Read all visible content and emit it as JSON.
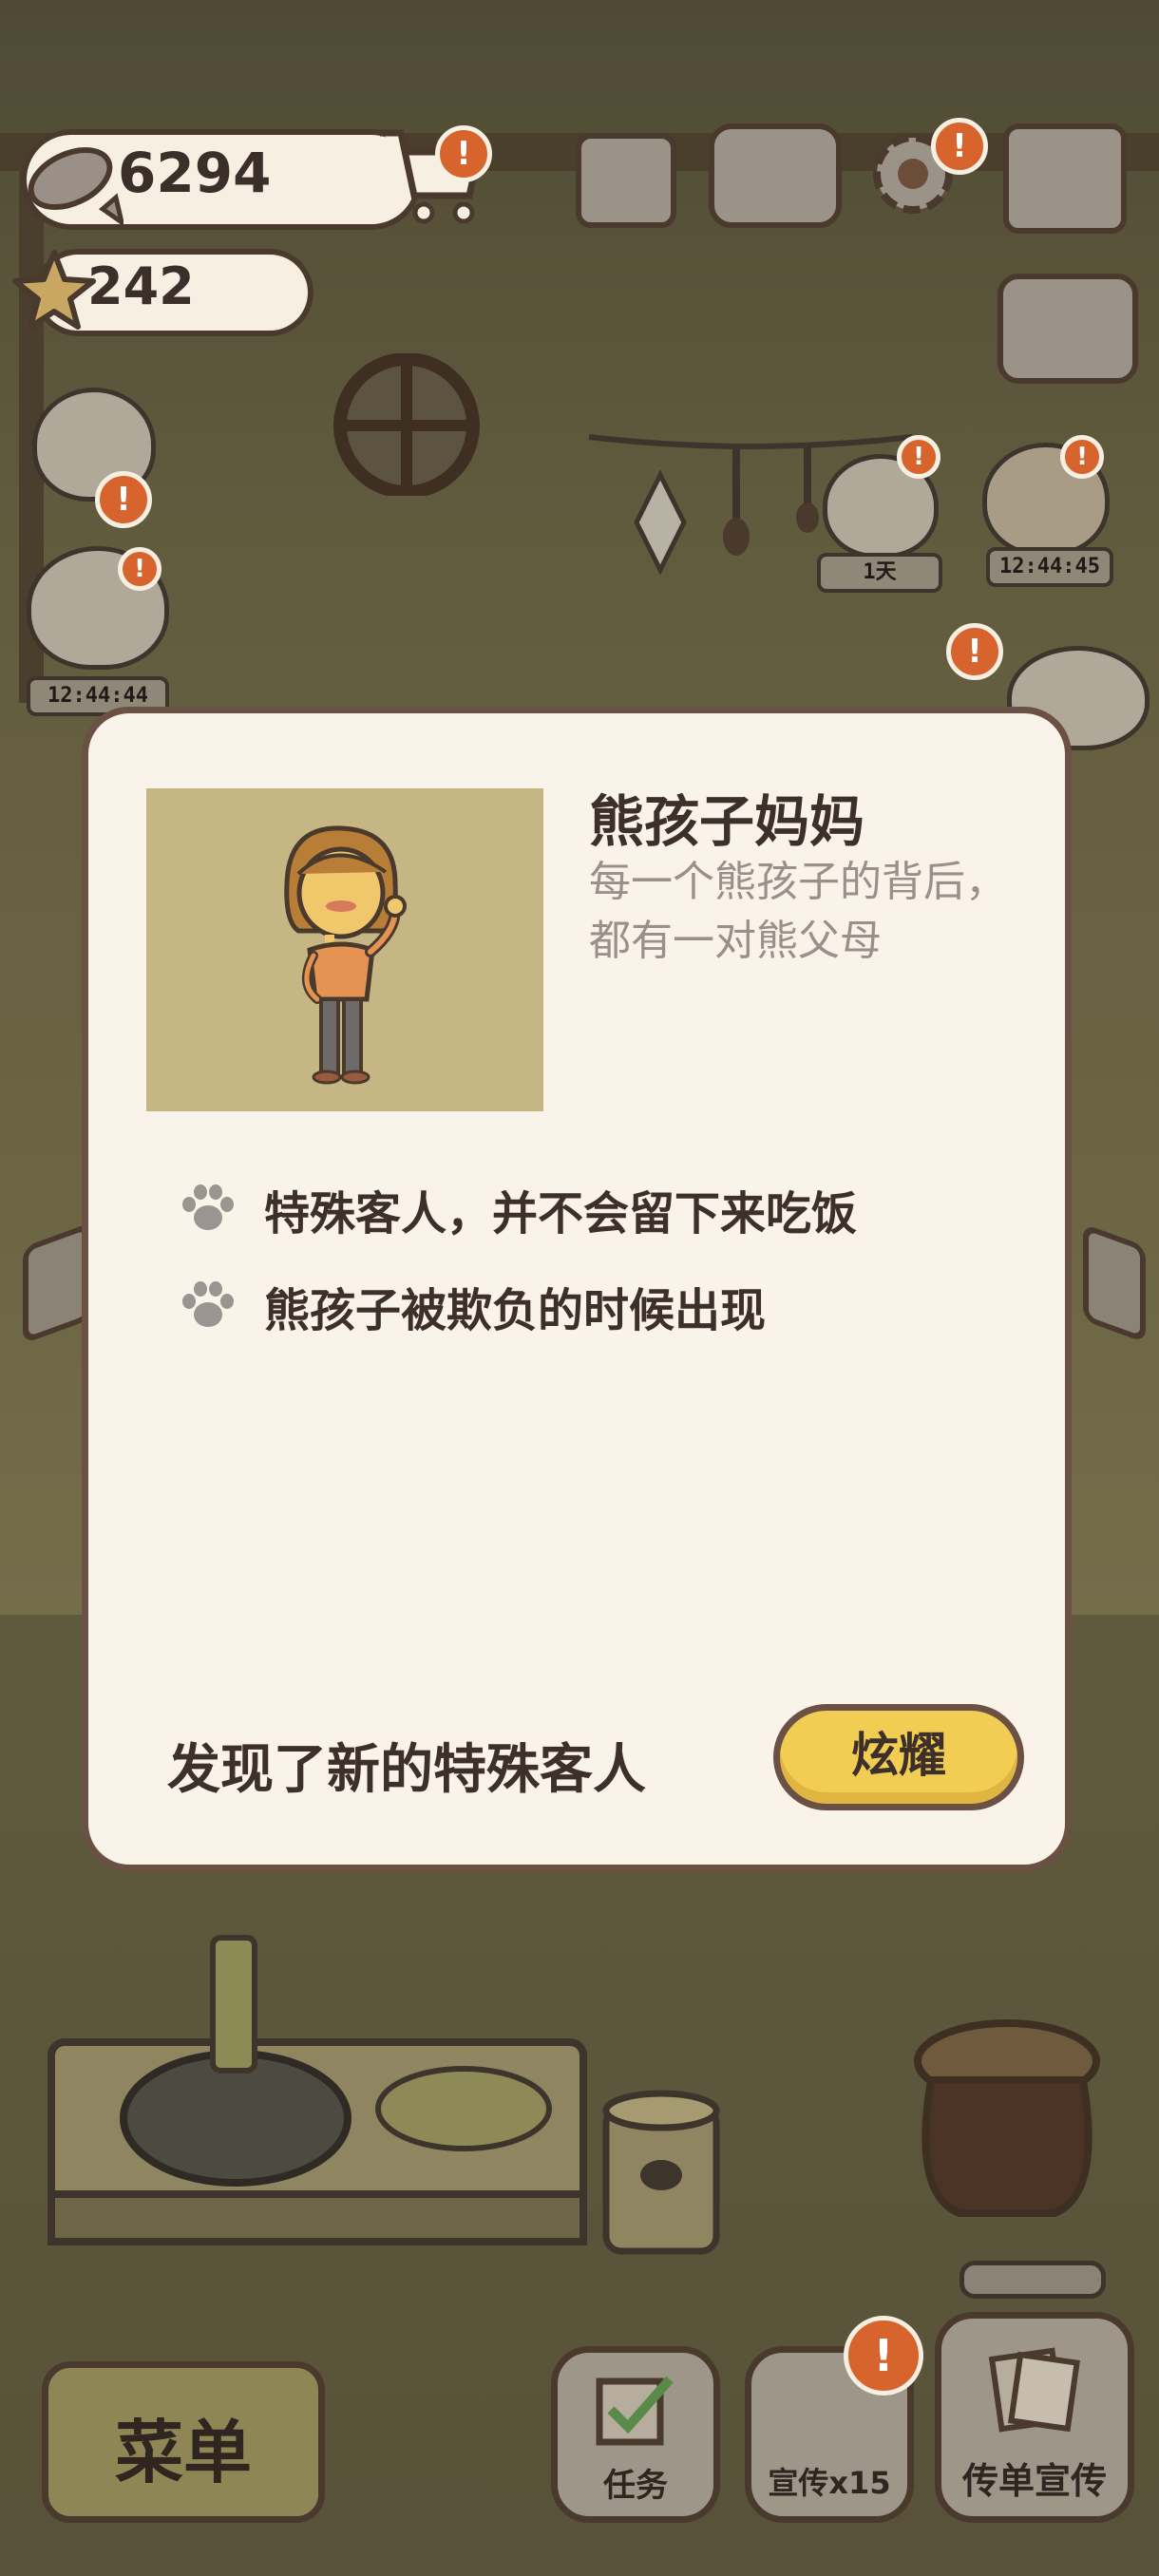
{
  "hud": {
    "fish_count": "6294",
    "star_count": "242",
    "timers": [
      "1天",
      "12:44:45",
      "12:44:44"
    ]
  },
  "icons": {
    "fish": "fish-icon",
    "star": "star-icon",
    "shop": "shopping-cart-icon",
    "notebook": "notebook-icon",
    "book": "open-book-icon",
    "settings": "gear-icon",
    "map": "map-icon",
    "swap": "up-down-arrows-icon",
    "paw": "paw-icon"
  },
  "dialog": {
    "name": "熊孩子妈妈",
    "description": "每一个熊孩子的背后，都有一对熊父母",
    "features": [
      "特殊客人，并不会留下来吃饭",
      "熊孩子被欺负的时候出现"
    ],
    "footer_text": "发现了新的特殊客人",
    "show_off_button": "炫耀"
  },
  "bottom_bar": {
    "menu_label": "菜单",
    "tasks_label": "任务",
    "promote_label": "宣传x15",
    "flyer_label": "传单宣传"
  },
  "colors": {
    "modal_bg": "#faf3ea",
    "modal_border": "#6a5144",
    "button_yellow": "#f2cd53",
    "alert_orange": "#d7632d",
    "portrait_bg": "#c5b683"
  }
}
